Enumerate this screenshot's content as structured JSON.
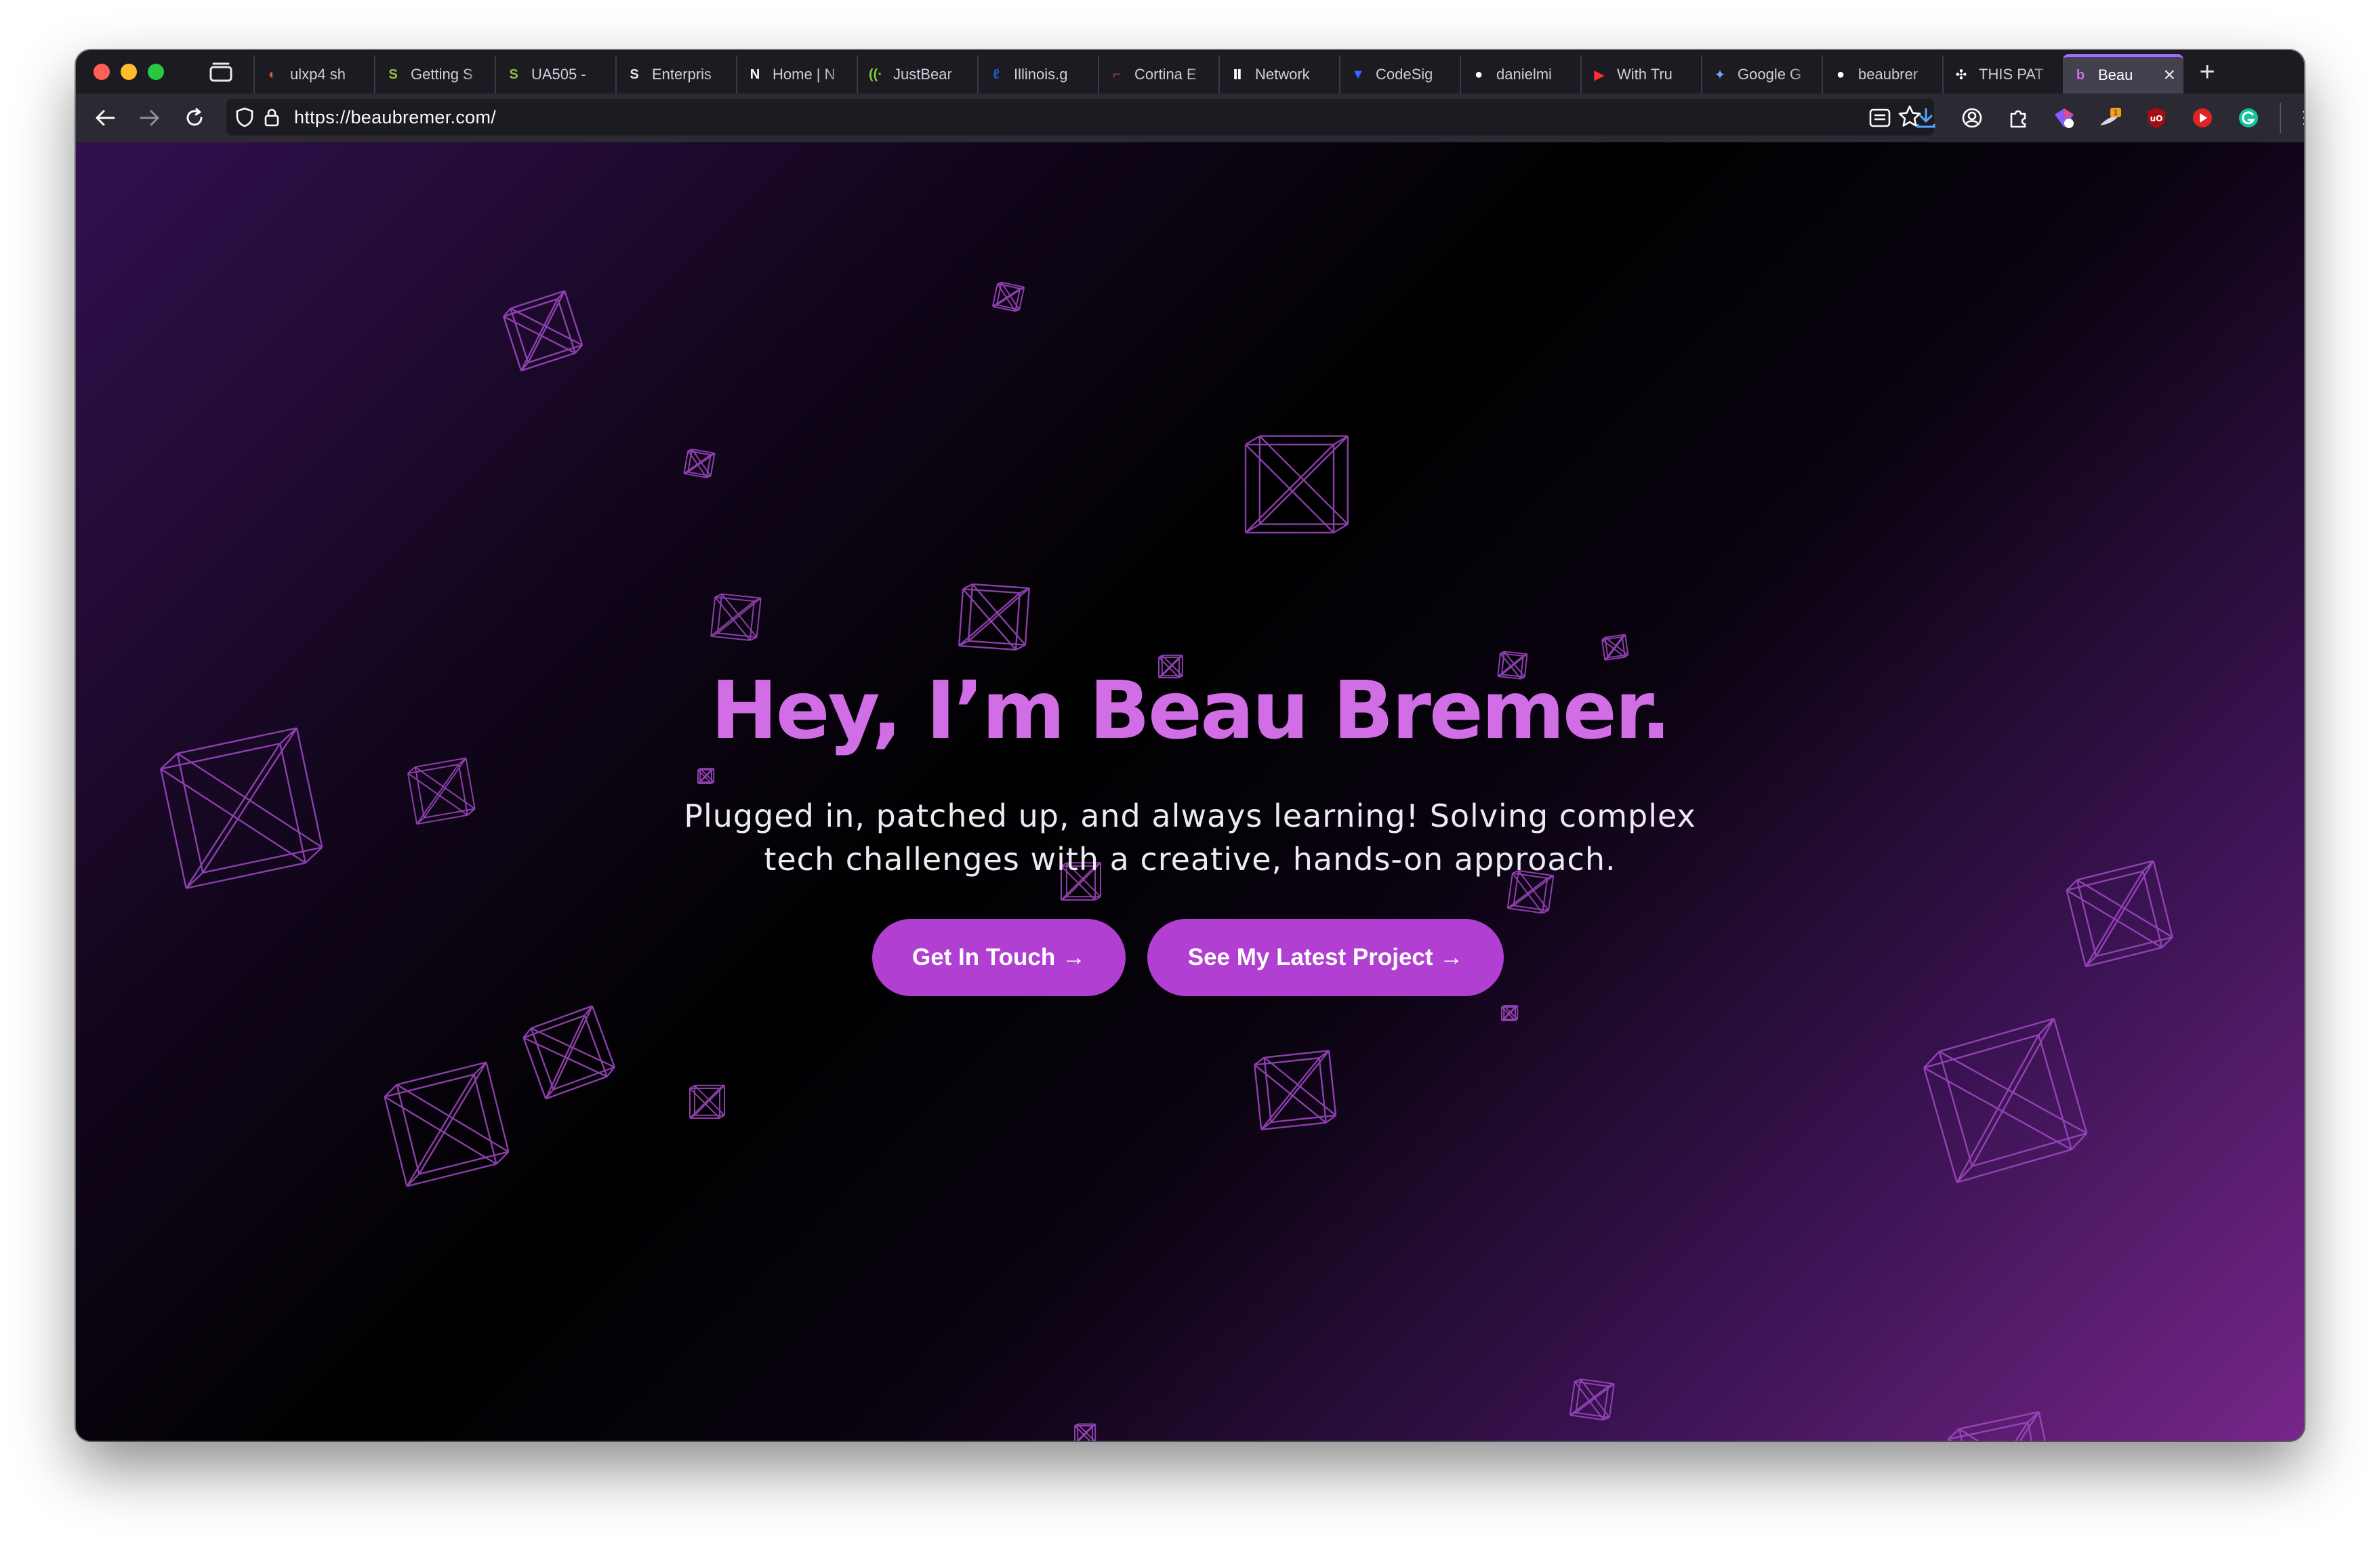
{
  "browser": {
    "tabs": [
      {
        "label": "ulxp4 sh",
        "icon": "duckduckgo-icon",
        "color": "#de5833",
        "glyph": "◐"
      },
      {
        "label": "Getting S",
        "icon": "shopify-s-icon",
        "color": "#95bf47",
        "glyph": "S"
      },
      {
        "label": "UA505 -",
        "icon": "shopify-s-icon",
        "color": "#95bf47",
        "glyph": "S"
      },
      {
        "label": "Enterpris",
        "icon": "s-logo-icon",
        "color": "#e6e6e6",
        "glyph": "S"
      },
      {
        "label": "Home | N",
        "icon": "notion-icon",
        "color": "#ffffff",
        "glyph": "N"
      },
      {
        "label": "JustBear",
        "icon": "radio-waves-icon",
        "color": "#7fd13b",
        "glyph": "((·"
      },
      {
        "label": "Illinois.g",
        "icon": "illinois-icon",
        "color": "#2456c6",
        "glyph": "ℓ"
      },
      {
        "label": "Cortina E",
        "icon": "cortina-icon",
        "color": "#c23a5a",
        "glyph": "⌐"
      },
      {
        "label": "Network",
        "icon": "network-icon",
        "color": "#ffffff",
        "glyph": "Ⅱ"
      },
      {
        "label": "CodeSig",
        "icon": "codesignal-icon",
        "color": "#2f6bff",
        "glyph": "▼"
      },
      {
        "label": "danielmi",
        "icon": "github-icon",
        "color": "#ffffff",
        "glyph": "●"
      },
      {
        "label": "With Tru",
        "icon": "youtube-icon",
        "color": "#ff2d2d",
        "glyph": "▶"
      },
      {
        "label": "Google G",
        "icon": "gemini-icon",
        "color": "#7aa2ff",
        "glyph": "✦"
      },
      {
        "label": "beaubrer",
        "icon": "github-icon",
        "color": "#ffffff",
        "glyph": "●"
      },
      {
        "label": "THIS PAT",
        "icon": "pinwheel-icon",
        "color": "#ffffff",
        "glyph": "✣"
      },
      {
        "label": "Beau",
        "icon": "beau-logo-icon",
        "color": "#d16ee6",
        "glyph": "b",
        "active": true
      }
    ],
    "url": "https://beaubremer.com/"
  },
  "hero": {
    "title": "Hey, I’m Beau Bremer.",
    "subtitle_line1": "Plugged in, patched up, and always learning! Solving complex",
    "subtitle_line2": "tech challenges with a creative, hands-on approach.",
    "cta_primary": "Get In Touch →",
    "cta_secondary": "See My Latest Project →"
  },
  "colors": {
    "accent": "#b03fd2",
    "title": "#d16ee6",
    "wireframe": "#a24ac4"
  }
}
